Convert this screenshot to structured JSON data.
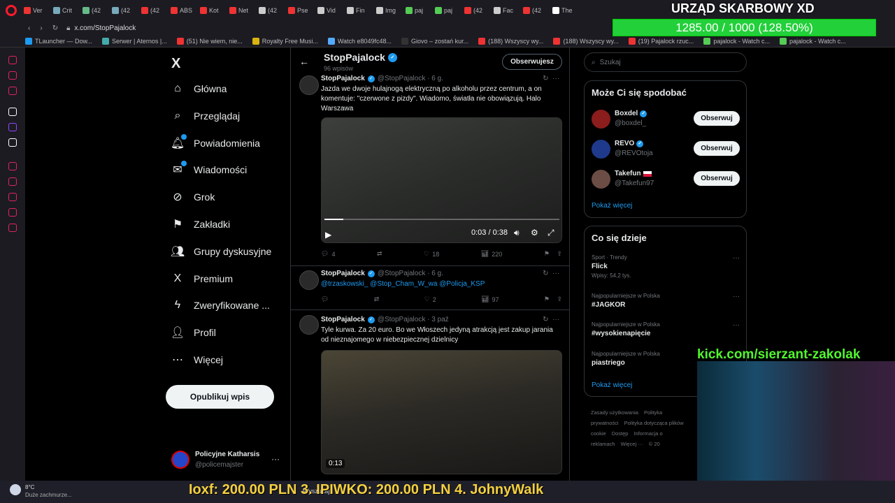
{
  "browser": {
    "tabs": [
      "Ver",
      "Crit",
      "(42",
      "(42",
      "(42",
      "ABS",
      "Kot",
      "Net",
      "(42",
      "Pse",
      "Vid",
      "Fin",
      "Img",
      "paj",
      "paj",
      "(42",
      "Fac",
      "(42",
      "The"
    ],
    "url": "x.com/StopPajalock",
    "bookmarks": [
      "TLauncher — Dow...",
      "Serwer | Aternos |...",
      "(51) Nie wiem, nie...",
      "Royalty Free Musi...",
      "Watch e8049fc48...",
      "Giovo – zostań kur...",
      "(188) Wszyscy wy...",
      "(188) Wszyscy wy...",
      "(19) Pajalock rzuc...",
      "pajalock - Watch c...",
      "pajalock - Watch c..."
    ]
  },
  "overlay": {
    "title": "URZĄD SKARBOWY XD",
    "progress_text": "1285.00 / 1000 (128.50%)",
    "progress_fraction": 1.0,
    "kick_url": "kick.com/sierzant-zakolak",
    "ticker": "Ioxf: 200.00 PLN    3. IPIWKO: 200.00 PLN    4. JohnyWalk"
  },
  "x": {
    "logo": "X",
    "nav": [
      {
        "label": "Główna",
        "icon": "home-icon",
        "glyph": "⌂"
      },
      {
        "label": "Przeglądaj",
        "icon": "search-icon",
        "glyph": "⌕"
      },
      {
        "label": "Powiadomienia",
        "icon": "bell-icon",
        "glyph": "🔔︎"
      },
      {
        "label": "Wiadomości",
        "icon": "mail-icon",
        "glyph": "✉"
      },
      {
        "label": "Grok",
        "icon": "grok-icon",
        "glyph": "⊘"
      },
      {
        "label": "Zakładki",
        "icon": "bookmark-icon",
        "glyph": "⚑"
      },
      {
        "label": "Grupy dyskusyjne",
        "icon": "communities-icon",
        "glyph": "👥︎"
      },
      {
        "label": "Premium",
        "icon": "premium-icon",
        "glyph": "X"
      },
      {
        "label": "Zweryfikowane ...",
        "icon": "lightning-icon",
        "glyph": "ϟ"
      },
      {
        "label": "Profil",
        "icon": "profile-icon",
        "glyph": "👤︎"
      },
      {
        "label": "Więcej",
        "icon": "more-icon",
        "glyph": "⋯"
      }
    ],
    "post_button": "Opublikuj wpis",
    "account": {
      "name": "Policyjne Katharsis",
      "handle": "@policemajster"
    },
    "profile_header": {
      "name": "StopPajalock",
      "posts": "96 wpisów",
      "follow_button": "Obserwujesz"
    },
    "tweets": [
      {
        "name": "StopPajalock",
        "handle": "@StopPajalock · 6 g.",
        "text": "Jazda we dwoje hulajnogą elektryczną po alkoholu przez centrum, a on komentuje: \"czerwone z pizdy\". Wiadomo, światła nie obowiązują. Halo Warszawa",
        "video_time": "0:03 / 0:38",
        "replies": "4",
        "retweets": "",
        "likes": "18",
        "views": "220"
      },
      {
        "name": "StopPajalock",
        "handle": "@StopPajalock · 6 g.",
        "text": "@trzaskowski_ @Stop_Cham_W_wa @Policja_KSP",
        "replies": "",
        "retweets": "",
        "likes": "2",
        "views": "97"
      },
      {
        "name": "StopPajalock",
        "handle": "@StopPajalock · 3 paź",
        "text": "Tyle kurwa. Za 20 euro. Bo we Włoszech jedyną atrakcją jest zakup jarania od nieznajomego w niebezpiecznej dzielnicy",
        "video_time": "0:13"
      }
    ],
    "search_placeholder": "Szukaj",
    "who_to_follow": {
      "title": "Może Ci się spodobać",
      "users": [
        {
          "name": "Boxdel",
          "handle": "@boxdel_",
          "button": "Obserwuj"
        },
        {
          "name": "REVO",
          "handle": "@REVOtoja",
          "button": "Obserwuj"
        },
        {
          "name": "Takefun",
          "handle": "@Takefun97",
          "button": "Obserwuj"
        }
      ],
      "show_more": "Pokaż więcej"
    },
    "trends": {
      "title": "Co się dzieje",
      "items": [
        {
          "category": "Sport · Trendy",
          "name": "Flick",
          "count": "Wpisy: 54,2 tys."
        },
        {
          "category": "Najpopularniejsze w Polska",
          "name": "#JAGKOR",
          "count": ""
        },
        {
          "category": "Najpopularniejsze w Polska",
          "name": "#wysokienapięcie",
          "count": ""
        },
        {
          "category": "Najpopularniejsze w Polska",
          "name": "piastriego",
          "count": ""
        }
      ],
      "show_more": "Pokaż więcej"
    },
    "footer": [
      "Zasady użytkowania",
      "Polityka prywatności",
      "Polityka dotycząca plików cookie",
      "Dostęp",
      "Informacja o reklamach",
      "Więcej ···",
      "© 20"
    ]
  },
  "taskbar": {
    "weather_temp": "8°C",
    "weather_desc": "Duże zachmurze...",
    "search": "Wyszukaj"
  }
}
